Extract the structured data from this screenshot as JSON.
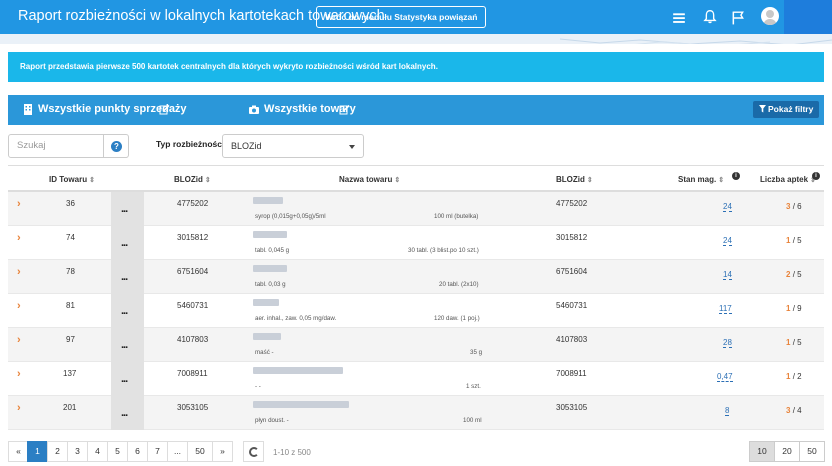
{
  "header": {
    "title": "Raport rozbieżności w lokalnych kartotekach towarowych",
    "back_button": "Wróć do modułu Statystyka powiązań"
  },
  "info_banner": "Raport przedstawia pierwsze 500 kartotek centralnych dla których wykryto rozbieżności wśród kart lokalnych.",
  "filters_bar": {
    "points_of_sale": "Wszystkie punkty sprzedaży",
    "products": "Wszystkie towary",
    "show_filters": "Pokaż filtry"
  },
  "search": {
    "placeholder": "Szukaj"
  },
  "discrepancy_type": {
    "label": "Typ rozbieżności",
    "selected": "BLOZid"
  },
  "table": {
    "headers": {
      "id": "ID Towaru",
      "blozid": "BLOZid",
      "name": "Nazwa towaru",
      "blozid2": "BLOZid",
      "stock": "Stan mag.",
      "pharmacies": "Liczba aptek"
    },
    "rows": [
      {
        "id": "36",
        "blozid": "4775202",
        "sub_left": "syrop (0,015g+0,05g)/5ml",
        "sub_right": "100 ml (butelka)",
        "blozid2": "4775202",
        "stock": "24",
        "ph_a": "3",
        "ph_b": "/ 6"
      },
      {
        "id": "74",
        "blozid": "3015812",
        "sub_left": "tabl. 0,045 g",
        "sub_right": "30 tabl. (3 blist.po 10 szt.)",
        "blozid2": "3015812",
        "stock": "24",
        "ph_a": "1",
        "ph_b": "/ 5"
      },
      {
        "id": "78",
        "blozid": "6751604",
        "sub_left": "tabl. 0,03 g",
        "sub_right": "20 tabl. (2x10)",
        "blozid2": "6751604",
        "stock": "14",
        "ph_a": "2",
        "ph_b": "/ 5"
      },
      {
        "id": "81",
        "blozid": "5460731",
        "sub_left": "aer. inhal., zaw. 0,05 mg/daw.",
        "sub_right": "120 daw. (1 poj.)",
        "blozid2": "5460731",
        "stock": "117",
        "ph_a": "1",
        "ph_b": "/ 9"
      },
      {
        "id": "97",
        "blozid": "4107803",
        "sub_left": "maść -",
        "sub_right": "35 g",
        "blozid2": "4107803",
        "stock": "28",
        "ph_a": "1",
        "ph_b": "/ 5"
      },
      {
        "id": "137",
        "blozid": "7008911",
        "sub_left": "- -",
        "sub_right": "1 szt.",
        "blozid2": "7008911",
        "stock": "0,47",
        "ph_a": "1",
        "ph_b": "/ 2"
      },
      {
        "id": "201",
        "blozid": "3053105",
        "sub_left": "płyn doust. -",
        "sub_right": "100 ml",
        "blozid2": "3053105",
        "stock": "8",
        "ph_a": "3",
        "ph_b": "/ 4"
      }
    ]
  },
  "pagination": {
    "prev": "«",
    "pages": [
      "1",
      "2",
      "3",
      "4",
      "5",
      "6",
      "7",
      "...",
      "50"
    ],
    "next": "»",
    "range": "1-10 z 500",
    "sizes": [
      "10",
      "20",
      "50"
    ],
    "active_page": "1",
    "active_size": "10"
  },
  "colors": {
    "accent": "#2196e3",
    "info": "#1ab7ea",
    "orange": "#e8833a",
    "link": "#2b6fb5"
  }
}
